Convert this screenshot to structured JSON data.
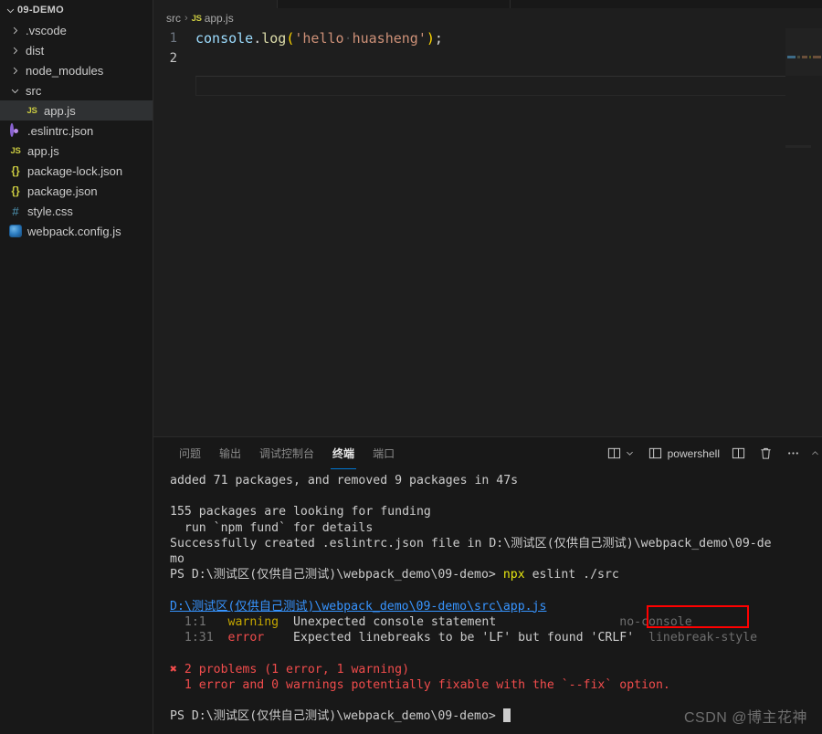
{
  "sidebar": {
    "root_label": "09-DEMO",
    "items": [
      {
        "label": ".vscode",
        "icon": "chevron-right-icon",
        "kind": "folder",
        "depth": 1,
        "selected": false
      },
      {
        "label": "dist",
        "icon": "chevron-right-icon",
        "kind": "folder",
        "depth": 1,
        "selected": false
      },
      {
        "label": "node_modules",
        "icon": "chevron-right-icon",
        "kind": "folder",
        "depth": 1,
        "selected": false
      },
      {
        "label": "src",
        "icon": "chevron-down-icon",
        "kind": "folder",
        "depth": 1,
        "selected": false
      },
      {
        "label": "app.js",
        "icon": "js-file-icon",
        "kind": "js",
        "depth": 2,
        "selected": true
      },
      {
        "label": ".eslintrc.json",
        "icon": "eslint-file-icon",
        "kind": "eslint",
        "depth": 1,
        "selected": false
      },
      {
        "label": "app.js",
        "icon": "js-file-icon",
        "kind": "js",
        "depth": 1,
        "selected": false
      },
      {
        "label": "package-lock.json",
        "icon": "json-file-icon",
        "kind": "json",
        "depth": 1,
        "selected": false
      },
      {
        "label": "package.json",
        "icon": "json-file-icon",
        "kind": "json",
        "depth": 1,
        "selected": false
      },
      {
        "label": "style.css",
        "icon": "css-file-icon",
        "kind": "css",
        "depth": 1,
        "selected": false
      },
      {
        "label": "webpack.config.js",
        "icon": "webpack-file-icon",
        "kind": "webpack",
        "depth": 1,
        "selected": false
      }
    ]
  },
  "breadcrumb": {
    "folder": "src",
    "separator": "›",
    "file_icon_label": "JS",
    "file": "app.js"
  },
  "editor": {
    "lines": [
      {
        "number": "1",
        "current": false,
        "tokens": [
          {
            "text": "console",
            "cls": "t-obj"
          },
          {
            "text": ".",
            "cls": "t-punc"
          },
          {
            "text": "log",
            "cls": "t-fn"
          },
          {
            "text": "(",
            "cls": "t-paren"
          },
          {
            "text": "'hello",
            "cls": "t-str"
          },
          {
            "text": "·",
            "cls": "t-dot"
          },
          {
            "text": "huasheng'",
            "cls": "t-str"
          },
          {
            "text": ")",
            "cls": "t-paren"
          },
          {
            "text": ";",
            "cls": "t-punc"
          }
        ]
      },
      {
        "number": "2",
        "current": true,
        "tokens": []
      }
    ]
  },
  "panel": {
    "tabs": [
      {
        "label": "问题",
        "active": false
      },
      {
        "label": "输出",
        "active": false
      },
      {
        "label": "调试控制台",
        "active": false
      },
      {
        "label": "终端",
        "active": true
      },
      {
        "label": "端口",
        "active": false
      }
    ],
    "actions": {
      "split_dropdown_icon": "split-editor-icon",
      "chevron_icon": "chevron-down-icon",
      "new_terminal_icon": "new-terminal-icon",
      "shell_name": "powershell",
      "split_terminal_icon": "split-terminal-icon",
      "kill_terminal_icon": "trash-icon",
      "more_actions_icon": "ellipsis-icon",
      "maximize_icon": "chevron-up-icon"
    }
  },
  "terminal": {
    "lines": [
      {
        "id": "l1",
        "segments": [
          {
            "text": "added 71 packages, and removed 9 packages in 47s",
            "cls": "c-white"
          }
        ]
      },
      {
        "id": "l2",
        "segments": [
          {
            "text": "",
            "cls": "c-white"
          }
        ]
      },
      {
        "id": "l3",
        "segments": [
          {
            "text": "155 packages are looking for funding",
            "cls": "c-white"
          }
        ]
      },
      {
        "id": "l4",
        "segments": [
          {
            "text": "  run `npm fund` for details",
            "cls": "c-white"
          }
        ]
      },
      {
        "id": "l5",
        "segments": [
          {
            "text": "Successfully created .eslintrc.json file in D:\\测试区(仅供自己测试)\\webpack_demo\\09-de",
            "cls": "c-white"
          }
        ]
      },
      {
        "id": "l6",
        "segments": [
          {
            "text": "mo",
            "cls": "c-white"
          }
        ]
      },
      {
        "id": "l7",
        "segments": [
          {
            "text": "PS D:\\测试区(仅供自己测试)\\webpack_demo\\09-demo> ",
            "cls": "c-white"
          },
          {
            "text": "npx",
            "cls": "c-yellow-b"
          },
          {
            "text": " eslint ./src",
            "cls": "c-white"
          }
        ]
      },
      {
        "id": "l8",
        "segments": [
          {
            "text": "",
            "cls": "c-white"
          }
        ]
      },
      {
        "id": "l9",
        "segments": [
          {
            "text": "D:\\测试区(仅供自己测试)\\webpack_demo\\09-demo\\src\\app.js",
            "cls": "c-link"
          }
        ]
      },
      {
        "id": "l10",
        "segments": [
          {
            "text": "  1:1   ",
            "cls": "c-dim"
          },
          {
            "text": "warning",
            "cls": "c-yellow"
          },
          {
            "text": "  Unexpected console statement        ",
            "cls": "c-white"
          },
          {
            "text": "         no-console",
            "cls": "c-gray"
          }
        ]
      },
      {
        "id": "l11",
        "segments": [
          {
            "text": "  1:31  ",
            "cls": "c-dim"
          },
          {
            "text": "error",
            "cls": "c-red-b"
          },
          {
            "text": "    Expected linebreaks to be 'LF' but found 'CRLF'  ",
            "cls": "c-white"
          },
          {
            "text": "linebreak-style",
            "cls": "c-gray"
          }
        ]
      },
      {
        "id": "l12",
        "segments": [
          {
            "text": "",
            "cls": "c-white"
          }
        ]
      },
      {
        "id": "l13",
        "segments": [
          {
            "text": "✖ 2 problems (1 error, 1 warning)",
            "cls": "c-red-b"
          }
        ]
      },
      {
        "id": "l14",
        "segments": [
          {
            "text": "  1 error and 0 warnings potentially fixable with the `--fix` option.",
            "cls": "c-red-b"
          }
        ]
      },
      {
        "id": "l15",
        "segments": [
          {
            "text": "",
            "cls": "c-white"
          }
        ]
      },
      {
        "id": "l16",
        "segments": [
          {
            "text": "PS D:\\测试区(仅供自己测试)\\webpack_demo\\09-demo> ",
            "cls": "c-white"
          }
        ],
        "cursor": true
      }
    ]
  },
  "annotation": {
    "highlight_text": "no-console",
    "color": "#FF0000"
  },
  "watermark": {
    "text": "CSDN @博主花神"
  },
  "colors": {
    "background": "#1E1E1E",
    "sidebar_bg": "#181818",
    "accent": "#0078D4",
    "error": "#F14C4C",
    "warning": "#C5A700",
    "link": "#3794FF"
  }
}
